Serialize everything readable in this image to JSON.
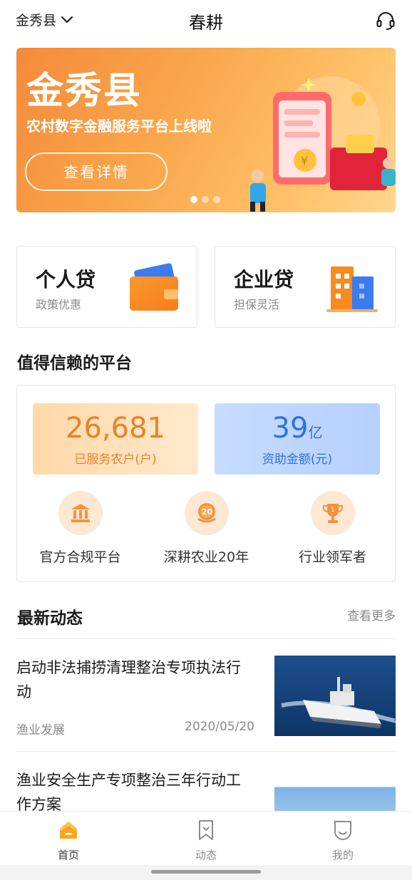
{
  "header": {
    "location": "金秀县",
    "title": "春耕",
    "support_icon": "headset-icon"
  },
  "banner": {
    "title": "金秀县",
    "subtitle": "农村数字金融服务平台上线啦",
    "button": "查看详情",
    "dot_count": 3,
    "active_dot": 1
  },
  "loans": [
    {
      "title": "个人贷",
      "subtitle": "政策优惠",
      "icon": "wallet-icon"
    },
    {
      "title": "企业贷",
      "subtitle": "担保灵活",
      "icon": "building-icon"
    }
  ],
  "trust": {
    "heading": "值得信赖的平台",
    "stats": [
      {
        "value": "26,681",
        "unit": "",
        "label": "已服务农户(户)"
      },
      {
        "value": "39",
        "unit": "亿",
        "label": "资助金额(元)"
      }
    ],
    "features": [
      {
        "label": "官方合规平台",
        "icon": "bank-icon"
      },
      {
        "label": "深耕农业20年",
        "icon": "badge-20-icon"
      },
      {
        "label": "行业领军者",
        "icon": "trophy-icon"
      }
    ]
  },
  "news": {
    "heading": "最新动态",
    "more": "查看更多",
    "items": [
      {
        "title": "启动非法捕捞清理整治专项执法行动",
        "category": "渔业发展",
        "date": "2020/05/20"
      },
      {
        "title": "渔业安全生产专项整治三年行动工作方案"
      }
    ]
  },
  "nav": {
    "items": [
      {
        "label": "首页",
        "icon": "home-icon",
        "active": true
      },
      {
        "label": "动态",
        "icon": "bookmark-icon",
        "active": false
      },
      {
        "label": "我的",
        "icon": "profile-icon",
        "active": false
      }
    ]
  },
  "colors": {
    "accent_orange": "#f5923e",
    "accent_blue": "#2d73d9"
  }
}
